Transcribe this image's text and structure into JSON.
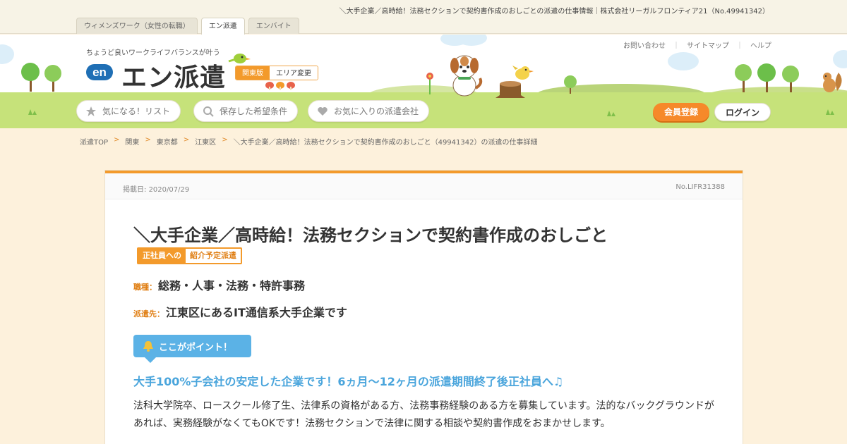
{
  "page_title": "＼大手企業／高時給！法務セクションで契約書作成のおしごとの派遣の仕事情報｜株式会社リーガルフロンティア21（No.49941342）",
  "tabs": [
    {
      "label": "ウィメンズワーク（女性の転職）"
    },
    {
      "label": "エン派遣"
    },
    {
      "label": "エンバイト"
    }
  ],
  "header": {
    "tagline": "ちょうど良いワークライフバランスが叶う",
    "logo_mark": "en",
    "logo_text": "エン派遣",
    "region": "関東版",
    "region_change": "エリア変更"
  },
  "utility_links": [
    {
      "label": "お問い合わせ"
    },
    {
      "label": "サイトマップ"
    },
    {
      "label": "ヘルプ"
    }
  ],
  "utility_separator": "｜",
  "nav": [
    {
      "label": "気になる！リスト",
      "icon": "star-icon"
    },
    {
      "label": "保存した希望条件",
      "icon": "search-icon"
    },
    {
      "label": "お気に入りの派遣会社",
      "icon": "heart-icon"
    }
  ],
  "auth": {
    "register": "会員登録",
    "login": "ログイン"
  },
  "breadcrumb": {
    "items": [
      "派遣TOP",
      "関東",
      "東京都",
      "江東区",
      "＼大手企業／高時給！法務セクションで契約書作成のおしごと（49941342）の派遣の仕事詳細"
    ],
    "separator": ">"
  },
  "job": {
    "posted_label": "掲載日:",
    "posted_date": "2020/07/29",
    "number": "No.LIFR31388",
    "title": "＼大手企業／高時給！法務セクションで契約書作成のおしごと",
    "badge_left": "正社員への",
    "badge_right": "紹介予定派遣",
    "occupation_label": "職種：",
    "occupation": "総務・人事・法務・特許事務",
    "destination_label": "派遣先：",
    "destination": "江東区にあるIT通信系大手企業です",
    "point_label": "ここがポイント！",
    "headline": "大手100%子会社の安定した企業です！6ヵ月～12ヶ月の派遣期間終了後正社員へ♫",
    "description": "法科大学院卒、ロースクール修了生、法律系の資格がある方、法務事務経験のある方を募集しています。法的なバックグラウンドがあれば、実務経験がなくてもOKです！法務セクションで法律に関する相談や契約書作成をおまかせします。"
  },
  "colors": {
    "accent_orange": "#f39a2b",
    "point_blue": "#5bb2e6",
    "ground_green": "#c6e27a",
    "page_bg": "#fdf1dc"
  }
}
